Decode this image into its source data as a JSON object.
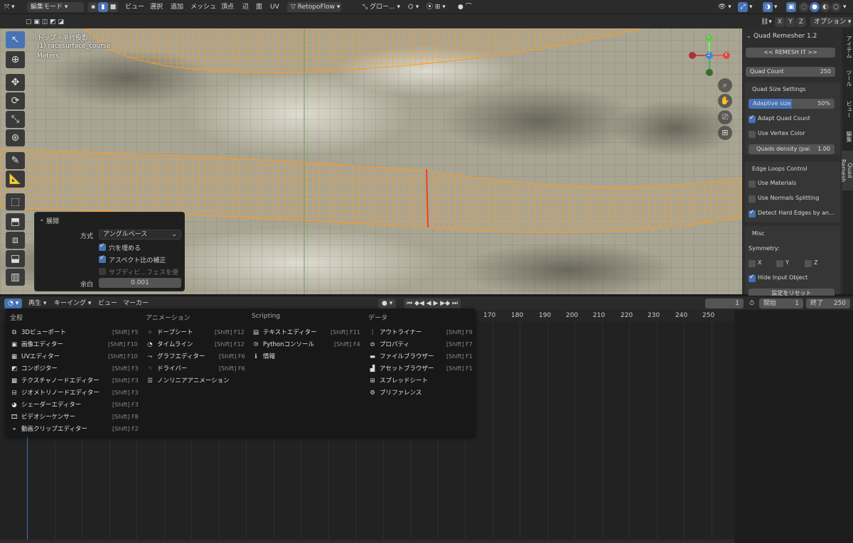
{
  "topbar": {
    "mode": "編集モード",
    "menus": [
      "ビュー",
      "選択",
      "追加",
      "メッシュ",
      "頂点",
      "辺",
      "面",
      "UV"
    ],
    "addon": "RetopoFlow",
    "transform_orientation": "グロー...",
    "options_label": "オプション"
  },
  "axis_buttons": [
    "X",
    "Y",
    "Z"
  ],
  "viewport": {
    "view_name": "トップ・平行投影",
    "object_name": "(1) racesurface_course",
    "units": "Meters",
    "gizmo_axes": [
      "Y",
      "X",
      "Z"
    ]
  },
  "redo_panel": {
    "title": "展開",
    "method_label": "方式",
    "method_value": "アングルベース",
    "fill_holes": "穴を埋める",
    "correct_aspect": "アスペクト比の補正",
    "use_subsurf": "サブディビ...フェスを使用",
    "margin_label": "余白",
    "margin_value": "0.001"
  },
  "npanel": {
    "title": "Quad Remesher 1.2",
    "remesh_button": "<< REMESH IT >>",
    "quad_count_label": "Quad Count",
    "quad_count_value": "250",
    "quad_size_header": "Quad Size Settings",
    "adaptive_label": "Adaptive size",
    "adaptive_value": "50%",
    "adaptive_level": 0.5,
    "adapt_quad_count": "Adapt Quad Count",
    "use_vertex_color": "Use Vertex Color",
    "quads_density_label": "Quads density (pai",
    "quads_density_value": "1.00",
    "edge_loops_header": "Edge Loops Control",
    "use_materials": "Use Materials",
    "use_normals_splitting": "Use Normals Splitting",
    "detect_hard_edges": "Detect Hard Edges by an...",
    "misc_header": "Misc",
    "symmetry_label": "Symmetry:",
    "sym_x": "X",
    "sym_y": "Y",
    "sym_z": "Z",
    "hide_input": "Hide Input Object",
    "reset_button": "設定をリセット"
  },
  "npanel_tabs": [
    "アイテム",
    "ツール",
    "ビュー",
    "編集",
    "Quad Remesh"
  ],
  "timeline": {
    "menus": [
      "再生",
      "キーイング",
      "ビュー",
      "マーカー"
    ],
    "current_frame": "1",
    "start_label": "開始",
    "start_value": "1",
    "end_label": "終了",
    "end_value": "250",
    "ruler": [
      "170",
      "180",
      "190",
      "200",
      "210",
      "220",
      "230",
      "240",
      "250"
    ]
  },
  "editor_menu": {
    "headers": [
      "全般",
      "アニメーション",
      "Scripting",
      "データ"
    ],
    "general": [
      {
        "label": "3Dビューポート",
        "shortcut": "[Shift] F5"
      },
      {
        "label": "画像エディター",
        "shortcut": "[Shift] F10"
      },
      {
        "label": "UVエディター",
        "shortcut": "[Shift] F10"
      },
      {
        "label": "コンポジター",
        "shortcut": "[Shift] F3"
      },
      {
        "label": "テクスチャノードエディター",
        "shortcut": "[Shift] F3"
      },
      {
        "label": "ジオメトリノードエディター",
        "shortcut": "[Shift] F3"
      },
      {
        "label": "シェーダーエディター",
        "shortcut": "[Shift] F3"
      },
      {
        "label": "ビデオシーケンサー",
        "shortcut": "[Shift] F8"
      },
      {
        "label": "動画クリップエディター",
        "shortcut": "[Shift] F2"
      }
    ],
    "animation": [
      {
        "label": "ドープシート",
        "shortcut": "[Shift] F12"
      },
      {
        "label": "タイムライン",
        "shortcut": "[Shift] F12"
      },
      {
        "label": "グラフエディター",
        "shortcut": "[Shift] F6"
      },
      {
        "label": "ドライバー",
        "shortcut": "[Shift] F6"
      },
      {
        "label": "ノンリニアアニメーション",
        "shortcut": ""
      }
    ],
    "scripting": [
      {
        "label": "テキストエディター",
        "shortcut": "[Shift] F11"
      },
      {
        "label": "Pythonコンソール",
        "shortcut": "[Shift] F4"
      },
      {
        "label": "情報",
        "shortcut": ""
      }
    ],
    "data": [
      {
        "label": "アウトライナー",
        "shortcut": "[Shift] F9"
      },
      {
        "label": "プロパティ",
        "shortcut": "[Shift] F7"
      },
      {
        "label": "ファイルブラウザー",
        "shortcut": "[Shift] F1"
      },
      {
        "label": "アセットブラウザー",
        "shortcut": "[Shift] F1"
      },
      {
        "label": "スプレッドシート",
        "shortcut": ""
      },
      {
        "label": "プリファレンス",
        "shortcut": ""
      }
    ]
  },
  "colors": {
    "accent": "#4772b3",
    "mesh": "#f08a1c"
  }
}
